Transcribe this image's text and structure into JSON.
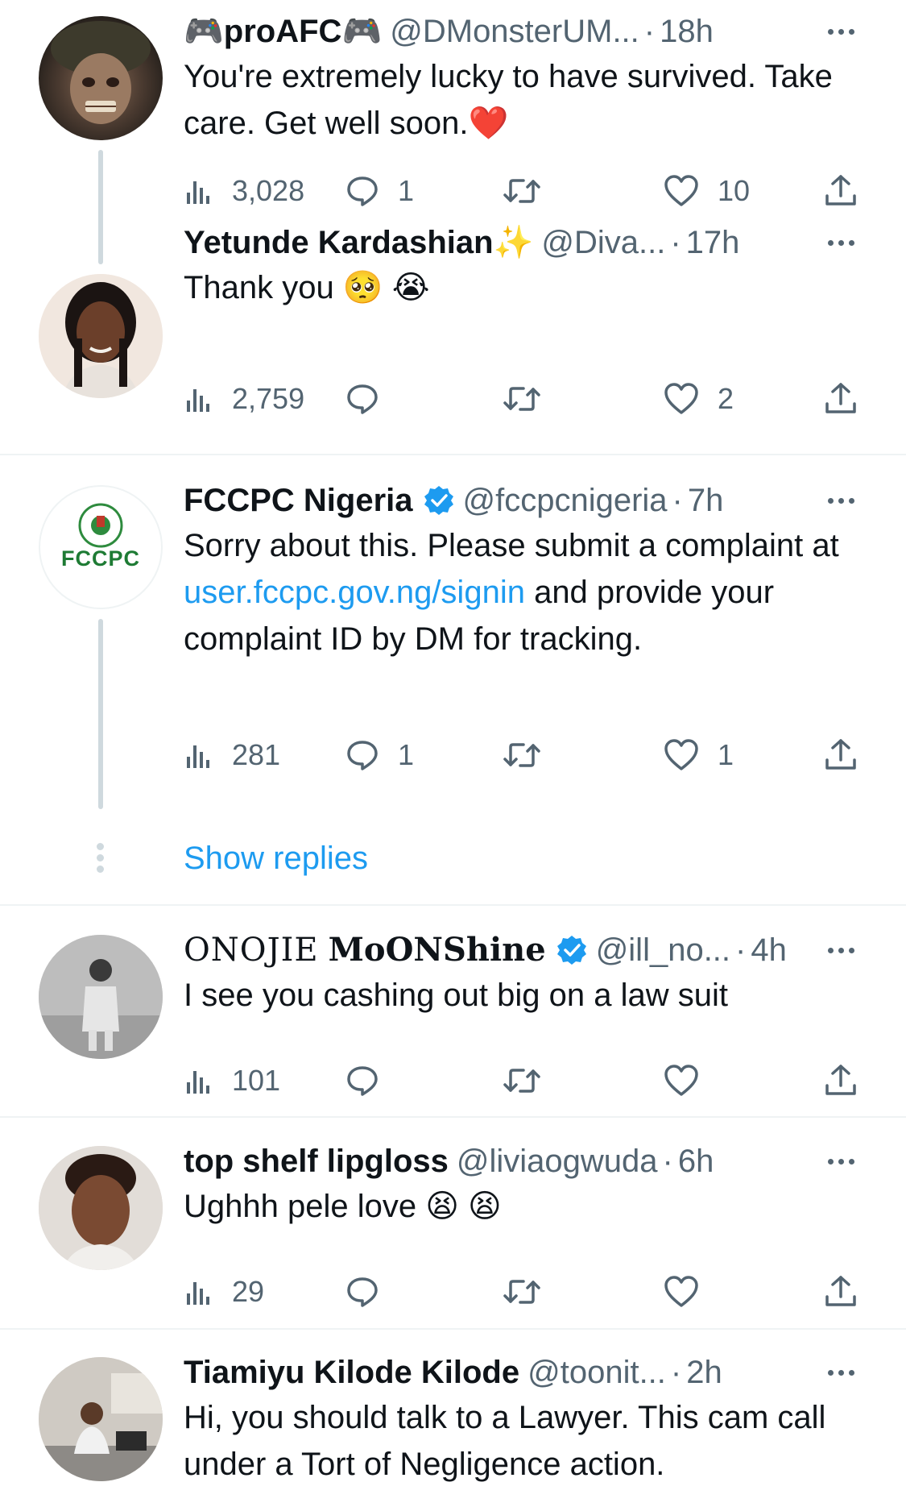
{
  "tweets": [
    {
      "name": "🎮proAFC🎮",
      "handle": "@DMonsterUM...",
      "time": "18h",
      "text": "You're extremely lucky to have survived. Take care. Get well soon.❤️",
      "views": "3,028",
      "replies": "1",
      "retweets": "",
      "likes": "10"
    },
    {
      "name": "Yetunde Kardashian✨",
      "handle": "@Diva...",
      "time": "17h",
      "text": "Thank you 🥺 😭",
      "views": "2,759",
      "replies": "",
      "retweets": "",
      "likes": "2"
    },
    {
      "name": "FCCPC Nigeria",
      "handle": "@fccpcnigeria",
      "time": "7h",
      "text_before": "Sorry about this. Please submit a complaint at ",
      "link": "user.fccpc.gov.ng/signin",
      "text_after": " and  provide your complaint ID by DM for tracking.",
      "views": "281",
      "replies": "1",
      "retweets": "",
      "likes": "1",
      "avatar_text": "FCCPC"
    },
    {
      "name_prefix": "ONOJIE",
      "name": "MoONShine",
      "handle": "@ill_no...",
      "time": "4h",
      "text": "I see you cashing out big on a law suit",
      "views": "101",
      "replies": "",
      "retweets": "",
      "likes": ""
    },
    {
      "name": "top shelf lipgloss",
      "handle": "@liviaogwuda",
      "time": "6h",
      "text": "Ughhh pele love 😫 😫",
      "views": "29",
      "replies": "",
      "retweets": "",
      "likes": ""
    },
    {
      "name": "Tiamiyu Kilode Kilode",
      "handle": "@toonit...",
      "time": "2h",
      "text": "Hi, you should talk to a Lawyer. This cam call under a Tort of Negligence action."
    }
  ],
  "show_replies": "Show replies",
  "dot": "·",
  "colors": {
    "link": "#1d9bf0",
    "secondary": "#536471",
    "thread_line": "#cfd9de",
    "verified": "#1d9bf0"
  },
  "icons": [
    "views-icon",
    "reply-icon",
    "retweet-icon",
    "like-icon",
    "share-icon",
    "verified-badge-icon",
    "more-icon"
  ]
}
